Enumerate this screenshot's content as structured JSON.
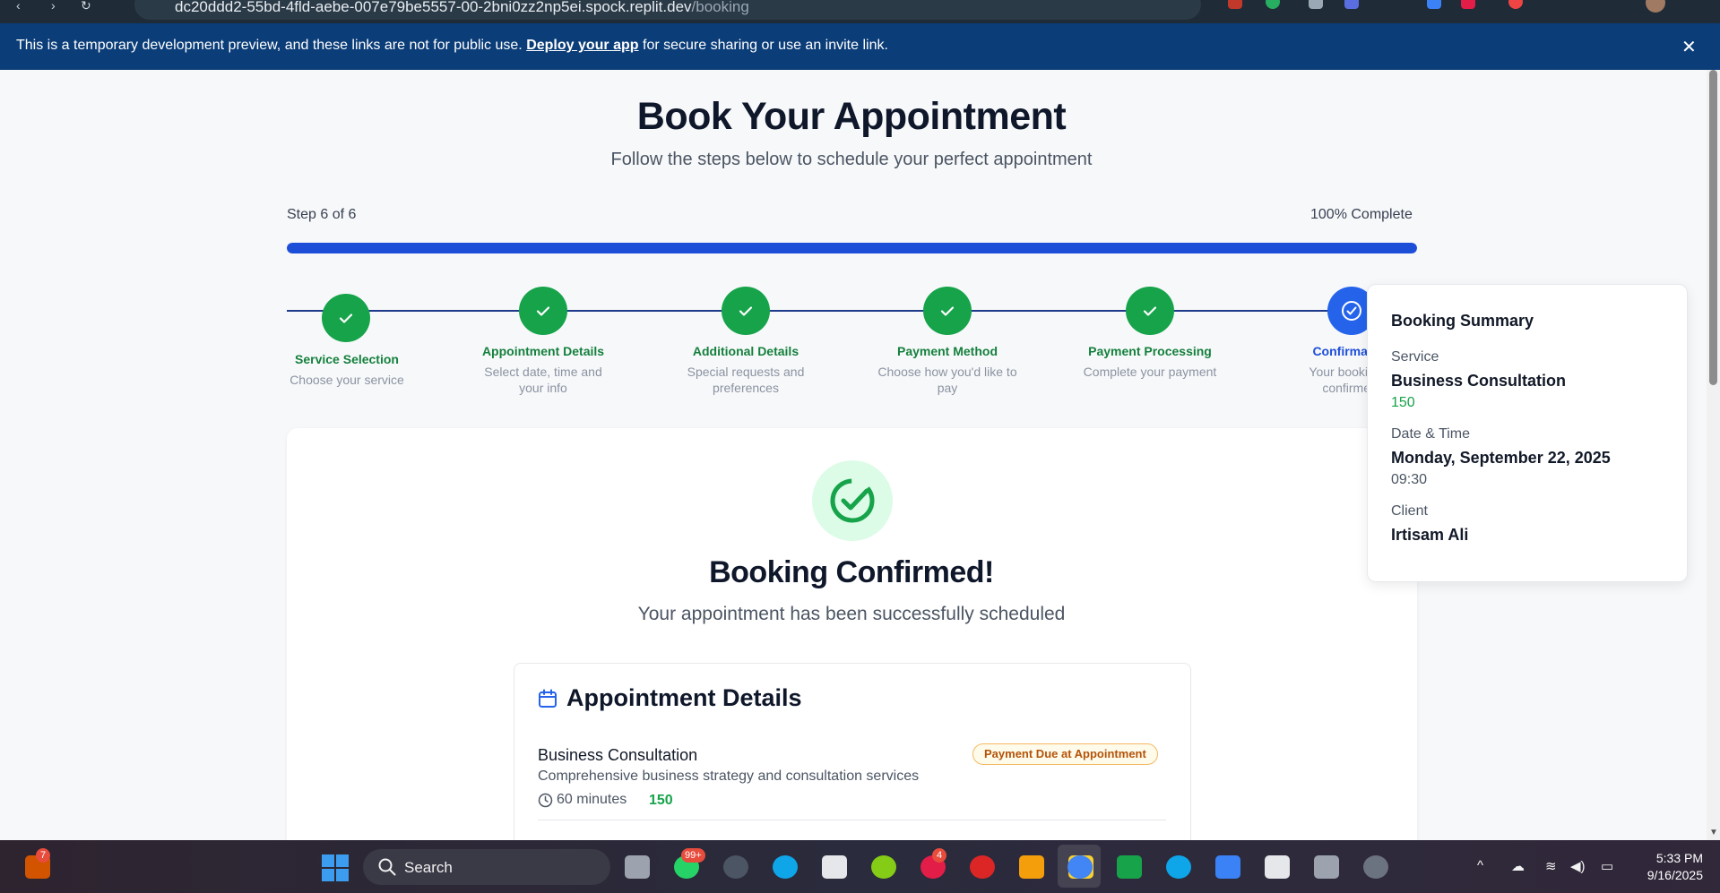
{
  "browser": {
    "url_host": "dc20ddd2-55bd-4fld-aebe-007e79be5557-00-2bni0zz2np5ei.spock.replit.dev",
    "url_path": "/booking"
  },
  "banner": {
    "text_before": "This is a temporary development preview, and these links are not for public use. ",
    "link_label": "Deploy your app",
    "text_after": " for secure sharing or use an invite link.",
    "close_label": "✕"
  },
  "header": {
    "title": "Book Your Appointment",
    "subtitle": "Follow the steps below to schedule your perfect appointment"
  },
  "progress": {
    "step_label": "Step 6 of 6",
    "complete_label": "100% Complete",
    "fraction": 1.0,
    "fill_color": "#1d4ed8"
  },
  "steps": [
    {
      "label": "Service Selection",
      "desc": "Choose your service",
      "state": "done"
    },
    {
      "label": "Appointment Details",
      "desc": "Select date, time and your info",
      "state": "done"
    },
    {
      "label": "Additional Details",
      "desc": "Special requests and preferences",
      "state": "done"
    },
    {
      "label": "Payment Method",
      "desc": "Choose how you'd like to pay",
      "state": "done"
    },
    {
      "label": "Payment Processing",
      "desc": "Complete your payment",
      "state": "done"
    },
    {
      "label": "Confirmation",
      "desc": "Your booking is confirmed!",
      "state": "current"
    }
  ],
  "confirmation": {
    "title": "Booking Confirmed!",
    "subtitle": "Your appointment has been successfully scheduled"
  },
  "appointment": {
    "section_title": "Appointment Details",
    "service_name": "Business Consultation",
    "service_desc": "Comprehensive business strategy and consultation services",
    "duration": "60 minutes",
    "price": "150",
    "payment_badge": "Payment Due at Appointment"
  },
  "summary": {
    "title": "Booking Summary",
    "service_label": "Service",
    "service_value": "Business Consultation",
    "service_price": "150",
    "datetime_label": "Date & Time",
    "date_value": "Monday, September 22, 2025",
    "time_value": "09:30",
    "client_label": "Client",
    "client_value": "Irtisam Ali"
  },
  "taskbar": {
    "search_label": "Search",
    "widget_badge": "7",
    "whatsapp_badge": "99+",
    "slack_badge": "4",
    "time": "5:33 PM",
    "date": "9/16/2025"
  },
  "colors": {
    "success": "#16a34a",
    "primary": "#2563eb",
    "banner": "#0b3d78"
  }
}
